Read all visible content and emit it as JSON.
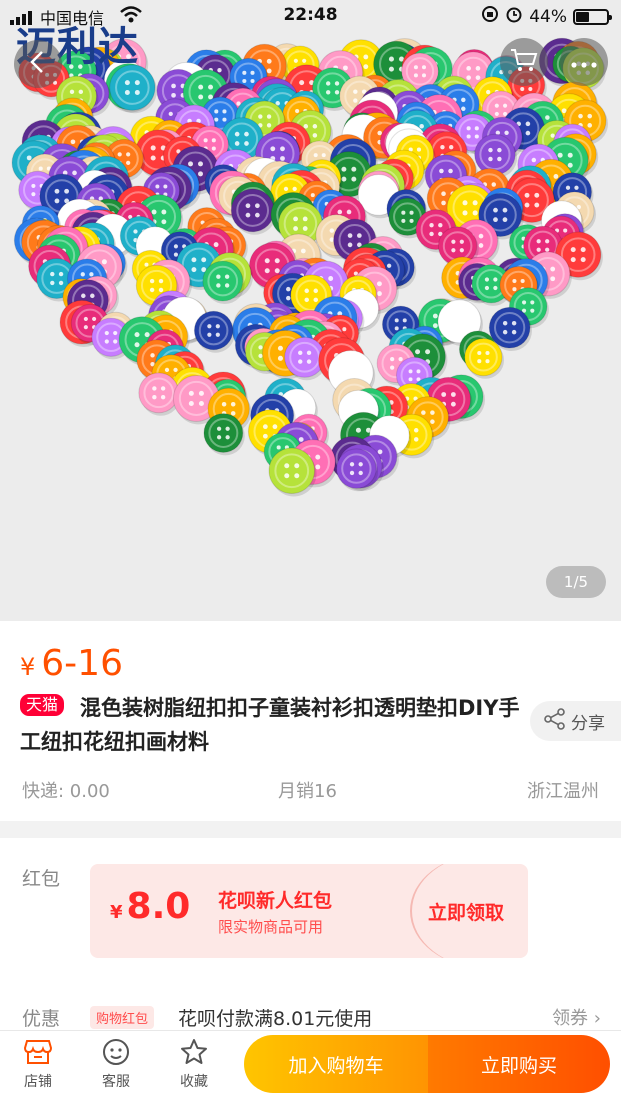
{
  "status_bar": {
    "carrier": "中国电信",
    "time": "22:48",
    "battery": "44%",
    "battery_level": 0.44
  },
  "watermark": "迈利达",
  "hero": {
    "pager": "1/5"
  },
  "product": {
    "currency": "¥",
    "price_range": "6-16",
    "badge": "天猫",
    "title": "混色装树脂纽扣扣子童装衬衫扣透明垫扣DIY手工纽扣花纽扣画材料",
    "share_label": "分享",
    "shipping": "快递: 0.00",
    "monthly_sales": "月销16",
    "location": "浙江温州"
  },
  "coupon_section": {
    "label": "红包",
    "currency": "¥",
    "amount": "8.0",
    "name": "花呗新人红包",
    "subtitle": "限实物商品可用",
    "claim": "立即领取"
  },
  "promo": {
    "label": "优惠",
    "tag": "购物红包",
    "text": "花呗付款满8.01元使用",
    "more": "领券"
  },
  "bottom_bar": {
    "shop": "店铺",
    "service": "客服",
    "favorite": "收藏",
    "add_to_cart": "加入购物车",
    "buy_now": "立即购买"
  },
  "icons": {
    "back": "chevron-left-icon",
    "cart": "cart-icon",
    "more": "more-dots-icon",
    "share": "share-icon",
    "shop": "shop-icon",
    "service": "service-face-icon",
    "favorite": "star-icon"
  },
  "colors": {
    "accent": "#ff5000",
    "tmall": "#ff0036",
    "coupon_bg": "#fde8e6",
    "coupon_text": "#ff2a2a",
    "cart_start": "#ffc500",
    "buy_end": "#ff4f00"
  }
}
